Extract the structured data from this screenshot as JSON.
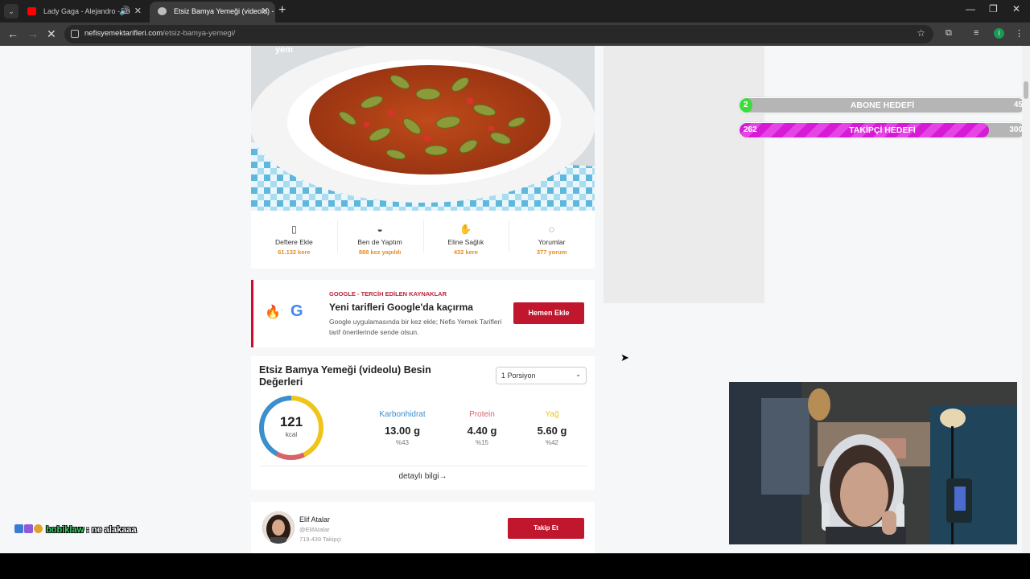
{
  "browser": {
    "tabs": [
      {
        "title": "Lady Gaga - Alejandro - Yo",
        "favicon_color": "#ff0000",
        "active": false
      },
      {
        "title": "Etsiz Bamya Yemeği (videolu) - ",
        "favicon_color": "#bdbdbd",
        "active": true
      }
    ],
    "url_host": "nefisyemektarifleri.com",
    "url_path": "/etsiz-bamya-yemegi/",
    "profile_initial": "I"
  },
  "recipe_image": {
    "overlay_text": "yem"
  },
  "stats": [
    {
      "label": "Deftere Ekle",
      "count": "61.132 kere",
      "icon": "notebook-icon"
    },
    {
      "label": "Ben de Yaptım",
      "count": "888 kez yapıldı",
      "icon": "pot-icon"
    },
    {
      "label": "Eline Sağlık",
      "count": "432 kere",
      "icon": "clap-icon"
    },
    {
      "label": "Yorumlar",
      "count": "377 yorum",
      "icon": "comment-icon"
    }
  ],
  "google_card": {
    "kicker": "GOOGLE - TERCİH EDİLEN KAYNAKLAR",
    "title": "Yeni tarifleri Google'da kaçırma",
    "desc": "Google uygulamasında bir kez ekle; Nefis Yemek Tarifleri tarif önerilerinde sende olsun.",
    "button": "Hemen Ekle",
    "separator": "·",
    "logo": "G"
  },
  "nutrition": {
    "title": "Etsiz Bamya Yemeği (videolu) Besin Değerleri",
    "portion": "1 Porsiyon",
    "kcal": "121",
    "kcal_unit": "kcal",
    "macros": [
      {
        "name": "Karbonhidrat",
        "value": "13.00 g",
        "pct": "%43",
        "color": "#3a8fd0"
      },
      {
        "name": "Protein",
        "value": "4.40 g",
        "pct": "%15",
        "color": "#d9636b"
      },
      {
        "name": "Yağ",
        "value": "5.60 g",
        "pct": "%42",
        "color": "#f0c419"
      }
    ],
    "more": "detaylı bilgi→"
  },
  "author": {
    "name": "Elif Atalar",
    "handle": "@ElifAtalar",
    "followers": "719.439 Takipçi",
    "follow_button": "Takip Et"
  },
  "overlay": {
    "sub_goal": {
      "current": "2",
      "label": "ABONE HEDEFİ",
      "target": "45",
      "progress": 0.044,
      "color": "#3ddc3d"
    },
    "follow_goal": {
      "current": "262",
      "label": "TAKİPÇİ HEDEFİ",
      "target": "300",
      "progress": 0.873,
      "color": "#d61ad6"
    },
    "chat": {
      "user": "bobiklaw",
      "message": " : ne alakaaa"
    }
  }
}
